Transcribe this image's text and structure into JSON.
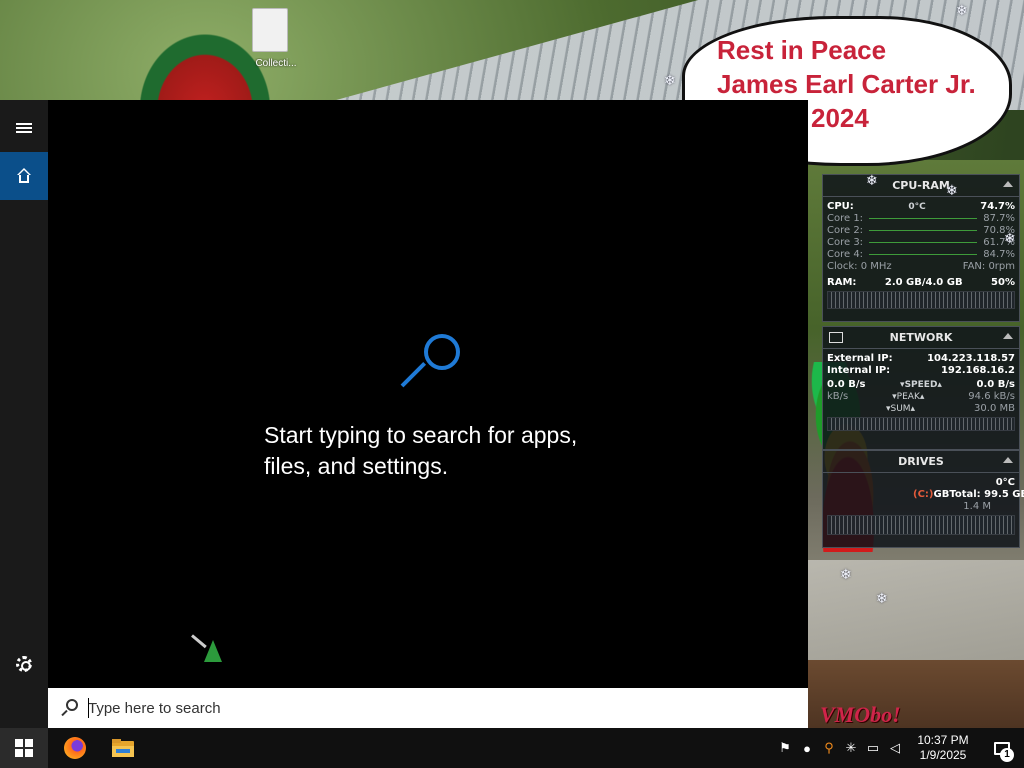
{
  "desktop": {
    "file_label": "Collecti...",
    "bubble_lines": [
      "Rest in Peace",
      "James Earl Carter Jr.",
      "2024"
    ],
    "signature": "VMObo!"
  },
  "gadgets": {
    "cpu_ram": {
      "title": "CPU-RAM",
      "cpu_label": "CPU:",
      "cpu_temp": "0°C",
      "cpu_value": "74.7%",
      "cores": [
        {
          "label": "Core 1:",
          "value": "87.7%"
        },
        {
          "label": "Core 2:",
          "value": "70.8%"
        },
        {
          "label": "Core 3:",
          "value": "61.7%"
        },
        {
          "label": "Core 4:",
          "value": "84.7%"
        }
      ],
      "clock": "Clock: 0 MHz",
      "fan": "FAN: 0rpm",
      "ram_label": "RAM:",
      "ram_used": "2.0 GB/4.0 GB",
      "ram_percent": "50%"
    },
    "network": {
      "title": "NETWORK",
      "external_ip_label": "External IP:",
      "external_ip": "104.223.118.57",
      "internal_ip_label": "Internal IP:",
      "internal_ip": "192.168.16.2",
      "rows": [
        {
          "left": "0.0 B/s",
          "mid": "▾SPEED▴",
          "right": "0.0 B/s"
        },
        {
          "left": "kB/s",
          "mid": "▾PEAK▴",
          "right": "94.6 kB/s"
        },
        {
          "left": "",
          "mid": "▾SUM▴",
          "right": "30.0 MB"
        }
      ]
    },
    "drives": {
      "title": "DRIVES",
      "temp": "0°C",
      "drive_label": "(C:)",
      "used": "GB",
      "total": "Total: 99.5 GB",
      "io": "1.4 M"
    }
  },
  "start": {
    "hint_line1": "Start typing to search for apps,",
    "hint_line2": "files, and settings.",
    "search_placeholder": "Type here to search"
  },
  "taskbar": {
    "time": "10:37 PM",
    "date": "1/9/2025",
    "notification_count": "1"
  },
  "icons": {
    "start": "windows-logo",
    "browser": "firefox",
    "explorer": "folder",
    "tray": [
      "user-alert",
      "droplet",
      "search-alt",
      "snowflake",
      "network",
      "speaker"
    ]
  },
  "colors": {
    "accent": "#0b4f8a",
    "search_blue": "#1f7ad6",
    "bubble_text": "#c8233a"
  }
}
